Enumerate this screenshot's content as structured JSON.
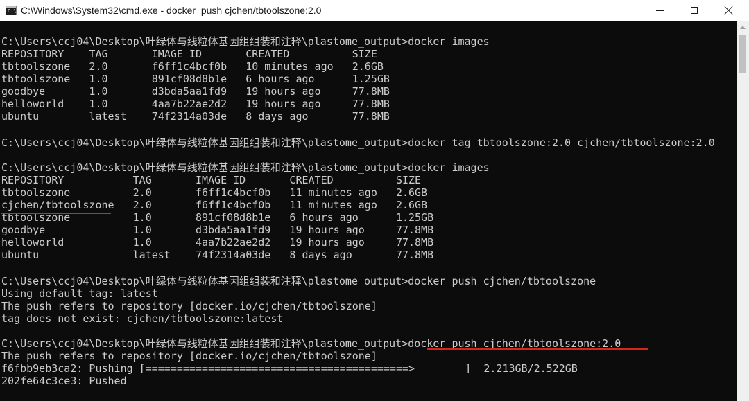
{
  "window": {
    "title": "C:\\Windows\\System32\\cmd.exe - docker  push cjchen/tbtoolszone:2.0",
    "app_icon_text": "C:\\",
    "minimize_icon": "minimize-icon",
    "maximize_icon": "maximize-icon",
    "close_icon": "close-icon"
  },
  "console": {
    "lines": [
      "",
      "C:\\Users\\ccj04\\Desktop\\叶绿体与线粒体基因组组装和注释\\plastome_output>docker images",
      "REPOSITORY    TAG       IMAGE ID       CREATED          SIZE",
      "tbtoolszone   2.0       f6ff1c4bcf0b   10 minutes ago   2.6GB",
      "tbtoolszone   1.0       891cf08d8b1e   6 hours ago      1.25GB",
      "goodbye       1.0       d3bda5aa1fd9   19 hours ago     77.8MB",
      "helloworld    1.0       4aa7b22ae2d2   19 hours ago     77.8MB",
      "ubuntu        latest    74f2314a03de   8 days ago       77.8MB",
      "",
      "C:\\Users\\ccj04\\Desktop\\叶绿体与线粒体基因组组装和注释\\plastome_output>docker tag tbtoolszone:2.0 cjchen/tbtoolszone:2.0",
      "",
      "C:\\Users\\ccj04\\Desktop\\叶绿体与线粒体基因组组装和注释\\plastome_output>docker images",
      "REPOSITORY           TAG       IMAGE ID       CREATED          SIZE",
      "tbtoolszone          2.0       f6ff1c4bcf0b   11 minutes ago   2.6GB",
      "cjchen/tbtoolszone   2.0       f6ff1c4bcf0b   11 minutes ago   2.6GB",
      "tbtoolszone          1.0       891cf08d8b1e   6 hours ago      1.25GB",
      "goodbye              1.0       d3bda5aa1fd9   19 hours ago     77.8MB",
      "helloworld           1.0       4aa7b22ae2d2   19 hours ago     77.8MB",
      "ubuntu               latest    74f2314a03de   8 days ago       77.8MB",
      "",
      "C:\\Users\\ccj04\\Desktop\\叶绿体与线粒体基因组组装和注释\\plastome_output>docker push cjchen/tbtoolszone",
      "Using default tag: latest",
      "The push refers to repository [docker.io/cjchen/tbtoolszone]",
      "tag does not exist: cjchen/tbtoolszone:latest",
      "",
      "C:\\Users\\ccj04\\Desktop\\叶绿体与线粒体基因组组装和注释\\plastome_output>docker push cjchen/tbtoolszone:2.0",
      "The push refers to repository [docker.io/cjchen/tbtoolszone]",
      "f6fbb9eb3ca2: Pushing [==========================================>        ]  2.213GB/2.522GB",
      "202fe64c3ce3: Pushed"
    ]
  },
  "colors": {
    "console_bg": "#0c0c0c",
    "console_text": "#cccccc",
    "annotation": "#d9261c"
  }
}
